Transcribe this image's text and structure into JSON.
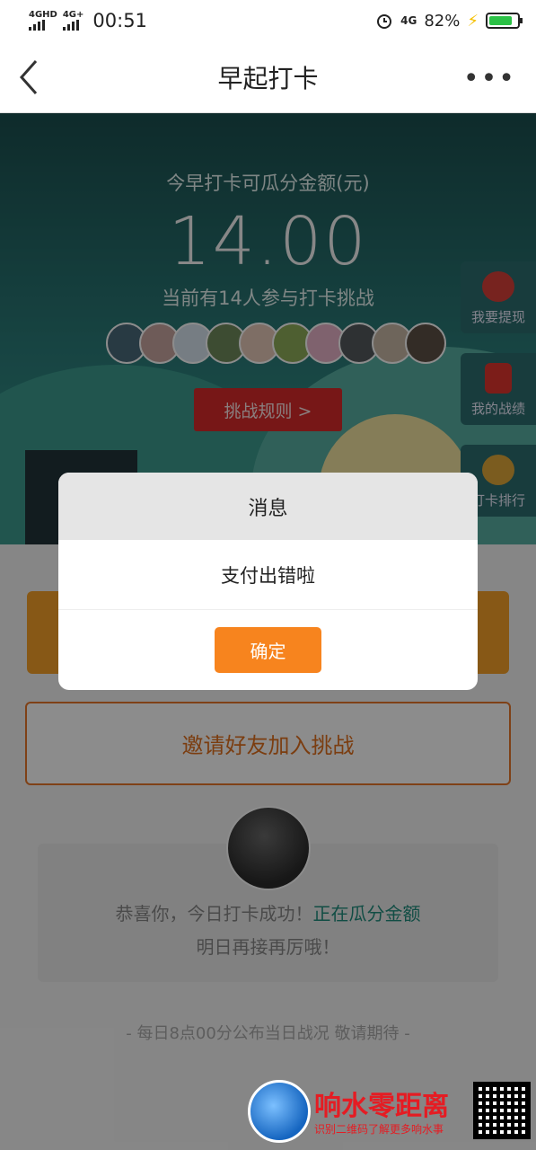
{
  "status_bar": {
    "network1": "4GHD",
    "network2": "4G+",
    "time": "00:51",
    "network3": "4G",
    "battery": "82%"
  },
  "nav": {
    "title": "早起打卡",
    "back_icon": "chevron-left-icon",
    "more_label": "•••"
  },
  "hero": {
    "pool_label": "今早打卡可瓜分金额(元)",
    "pool_amount": "14.00",
    "participants_text": "当前有14人参与打卡挑战",
    "rules_button": "挑战规则 >"
  },
  "side_buttons": [
    {
      "label": "我要提现",
      "icon": "money-bag-icon"
    },
    {
      "label": "我的战绩",
      "icon": "red-envelope-icon"
    },
    {
      "label": "打卡排行",
      "icon": "medal-icon"
    }
  ],
  "dialog": {
    "title": "消息",
    "message": "支付出错啦",
    "ok_button": "确定"
  },
  "main": {
    "invite_button": "邀请好友加入挑战",
    "success_prefix": "恭喜你，今日打卡成功！",
    "success_highlight": "正在瓜分金额",
    "success_line2": "明日再接再厉哦！",
    "footer_note": "- 每日8点00分公布当日战况 敬请期待 -"
  },
  "watermark": {
    "title": "响水零距离",
    "subtitle": "识别二维码了解更多响水事"
  },
  "colors": {
    "accent_orange": "#f7841e",
    "rules_red": "#d92b2b",
    "hero_teal": "#2b7d7a",
    "highlight_green": "#1f8c7d"
  }
}
